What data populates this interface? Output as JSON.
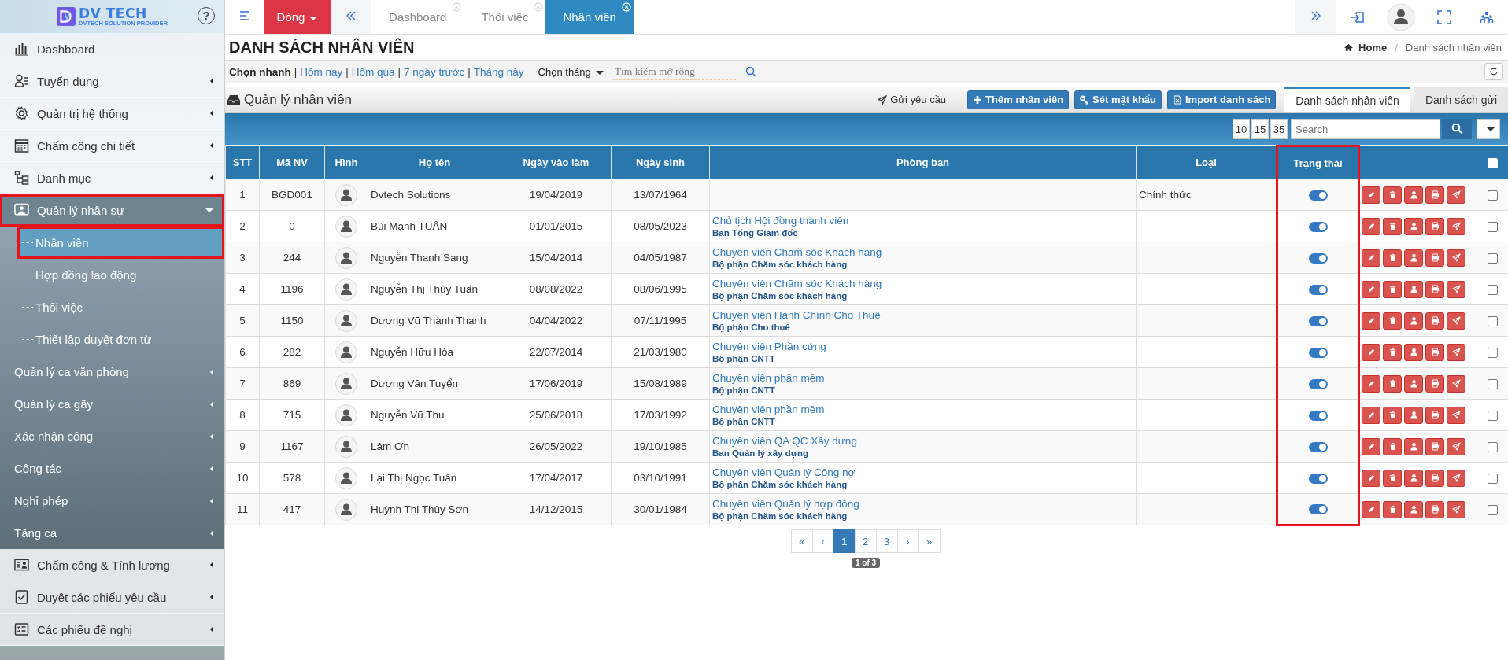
{
  "sidebar": {
    "logo": {
      "title": "DV TECH",
      "tagline": "DVTECH SOLUTION PROVIDER"
    },
    "help": "?",
    "items": [
      {
        "label": "Dashboard"
      },
      {
        "label": "Tuyển dụng",
        "expanded": false,
        "highlighted": false
      },
      {
        "label": "Quản trị hệ thống",
        "expanded": false,
        "highlighted": false
      },
      {
        "label": "Chấm công chi tiết",
        "expanded": false,
        "highlighted": false
      },
      {
        "label": "Danh mục",
        "expanded": false,
        "highlighted": false
      },
      {
        "label": "Quản lý nhân sự",
        "expanded": true,
        "highlighted": true,
        "children": [
          {
            "kind": "page",
            "label": "Nhân viên",
            "selected": true,
            "highlighted": true
          },
          {
            "kind": "page",
            "label": "Hợp đồng lao động",
            "selected": false,
            "highlighted": false
          },
          {
            "kind": "page",
            "label": "Thôi việc",
            "selected": false,
            "highlighted": false
          },
          {
            "kind": "page",
            "label": "Thiết lập duyệt đơn từ",
            "selected": false,
            "highlighted": false
          },
          {
            "kind": "group",
            "label": "Quản lý ca văn phòng",
            "selected": false,
            "highlighted": false
          },
          {
            "kind": "group",
            "label": "Quản lý ca gãy",
            "selected": false,
            "highlighted": false
          },
          {
            "kind": "group",
            "label": "Xác nhận công",
            "selected": false,
            "highlighted": false
          },
          {
            "kind": "group",
            "label": "Công tác",
            "selected": false,
            "highlighted": false
          },
          {
            "kind": "group",
            "label": "Nghỉ phép",
            "selected": false,
            "highlighted": false
          },
          {
            "kind": "group",
            "label": "Tăng ca",
            "selected": false,
            "highlighted": false
          }
        ]
      },
      {
        "label": "Chấm công & Tính lương",
        "expanded": false,
        "highlighted": false
      },
      {
        "label": "Duyệt các phiếu yêu cầu",
        "expanded": false,
        "highlighted": false
      },
      {
        "label": "Các phiếu đề nghị",
        "expanded": false,
        "highlighted": false
      }
    ]
  },
  "topbar": {
    "close_menu": "Đóng",
    "tabs": [
      {
        "label": "Dashboard",
        "selected": false
      },
      {
        "label": "Thôi việc",
        "selected": false
      },
      {
        "label": "Nhân viên",
        "selected": true
      }
    ]
  },
  "page": {
    "title": "DANH SÁCH NHÂN VIÊN",
    "breadcrumb": [
      {
        "label": "Home"
      },
      {
        "separator": "/",
        "label": "Danh sách nhân viên"
      }
    ]
  },
  "quick_filter": {
    "label": "Chọn nhanh",
    "links": [
      {
        "separator": "|",
        "label": "Hôm nay"
      },
      {
        "separator": "|",
        "label": "Hôm qua"
      },
      {
        "separator": "|",
        "label": "7 ngày trước"
      },
      {
        "separator": "|",
        "label": "Tháng này"
      }
    ],
    "month_select": "Chọn tháng",
    "search": {
      "placeholder": "Tìm kiếm mở rộng"
    }
  },
  "panel": {
    "title": "Quản lý nhân viên",
    "actions": [
      {
        "kind": "plain",
        "label": "Gửi yêu cầu"
      },
      {
        "kind": "add",
        "label": "Thêm nhân viên"
      },
      {
        "kind": "key",
        "label": "Sét mật khẩu"
      },
      {
        "kind": "import",
        "label": "Import danh sách"
      }
    ],
    "tabs": [
      {
        "label": "Danh sách nhân viên",
        "selected": true
      },
      {
        "label": "Danh sách gửi",
        "selected": false
      }
    ]
  },
  "table_toolbar": {
    "page_sizes": [
      "10",
      "15",
      "35"
    ],
    "search": {
      "placeholder": "Search"
    }
  },
  "table": {
    "select_all_checked": false,
    "columns": [
      {
        "label": "STT",
        "highlighted": false
      },
      {
        "label": "Mã NV",
        "highlighted": false
      },
      {
        "label": "Hình",
        "highlighted": false
      },
      {
        "label": "Họ tên",
        "highlighted": false
      },
      {
        "label": "Ngày vào làm",
        "highlighted": false
      },
      {
        "label": "Ngày sinh",
        "highlighted": false
      },
      {
        "label": "Phòng ban",
        "highlighted": false
      },
      {
        "label": "Loại",
        "highlighted": false
      },
      {
        "label": "Trạng thái",
        "highlighted": true
      }
    ],
    "rows": [
      {
        "stt": "1",
        "code": "BGD001",
        "name": "Dvtech Solutions",
        "start_date": "19/04/2019",
        "birth_date": "13/07/1964",
        "type": "Chính thức",
        "on": true,
        "checked": false
      },
      {
        "stt": "2",
        "code": "0",
        "name": "Bùi Mạnh TUẤN",
        "start_date": "01/01/2015",
        "birth_date": "08/05/2023",
        "position": "Chủ tịch Hội đồng thành viên",
        "department": "Ban Tổng Giám đốc",
        "on": true,
        "checked": false
      },
      {
        "stt": "3",
        "code": "244",
        "name": "Nguyễn Thanh Sang",
        "start_date": "15/04/2014",
        "birth_date": "04/05/1987",
        "position": "Chuyên viên Chăm sóc Khách hàng",
        "department": "Bộ phận Chăm sóc khách hàng",
        "on": true,
        "checked": false
      },
      {
        "stt": "4",
        "code": "1196",
        "name": "Nguyễn Thị Thùy Tuấn",
        "start_date": "08/08/2022",
        "birth_date": "08/06/1995",
        "position": "Chuyên viên Chăm sóc Khách hàng",
        "department": "Bộ phận Chăm sóc khách hàng",
        "on": true,
        "checked": false
      },
      {
        "stt": "5",
        "code": "1150",
        "name": "Dương Vũ Thành Thanh",
        "start_date": "04/04/2022",
        "birth_date": "07/11/1995",
        "position": "Chuyên viên Hành Chính Cho Thuê",
        "department": "Bộ phận Cho thuê",
        "on": true,
        "checked": false
      },
      {
        "stt": "6",
        "code": "282",
        "name": "Nguyễn Hữu Hòa",
        "start_date": "22/07/2014",
        "birth_date": "21/03/1980",
        "position": "Chuyên viên Phần cứng",
        "department": "Bộ phận CNTT",
        "on": true,
        "checked": false
      },
      {
        "stt": "7",
        "code": "869",
        "name": "Dương Văn Tuyển",
        "start_date": "17/06/2019",
        "birth_date": "15/08/1989",
        "position": "Chuyên viên phần mềm",
        "department": "Bộ phận CNTT",
        "on": true,
        "checked": false
      },
      {
        "stt": "8",
        "code": "715",
        "name": "Nguyễn Vũ Thu",
        "start_date": "25/06/2018",
        "birth_date": "17/03/1992",
        "position": "Chuyên viên phần mềm",
        "department": "Bộ phận CNTT",
        "on": true,
        "checked": false
      },
      {
        "stt": "9",
        "code": "1167",
        "name": "Lâm Ơn",
        "start_date": "26/05/2022",
        "birth_date": "19/10/1985",
        "position": "Chuyên viên QA QC Xây dựng",
        "department": "Ban Quản lý xây dựng",
        "on": true,
        "checked": false
      },
      {
        "stt": "10",
        "code": "578",
        "name": "Lại Thị Ngọc Tuấn",
        "start_date": "17/04/2017",
        "birth_date": "03/10/1991",
        "position": "Chuyên viên Quản lý Công nợ",
        "department": "Bộ phận Chăm sóc khách hàng",
        "on": true,
        "checked": false
      },
      {
        "stt": "11",
        "code": "417",
        "name": "Huỳnh Thị Thùy Sơn",
        "start_date": "14/12/2015",
        "birth_date": "30/01/1984",
        "position": "Chuyên viên Quản lý hợp đồng",
        "department": "Bộ phận Chăm sóc khách hàng",
        "on": true,
        "checked": false
      }
    ]
  },
  "pagination": {
    "pages": [
      {
        "label": "«",
        "selected": false
      },
      {
        "label": "‹",
        "selected": false
      },
      {
        "label": "1",
        "selected": true
      },
      {
        "label": "2",
        "selected": false
      },
      {
        "label": "3",
        "selected": false
      },
      {
        "label": "›",
        "selected": false
      },
      {
        "label": "»",
        "selected": false
      }
    ],
    "info": "1 of 3"
  }
}
